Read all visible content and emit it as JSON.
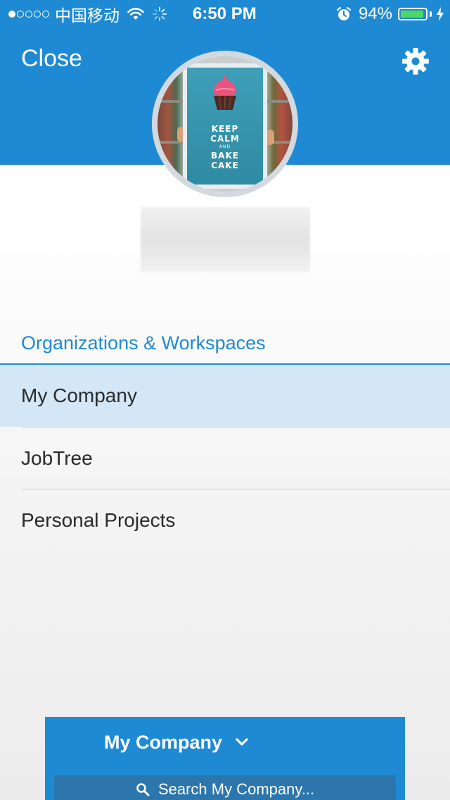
{
  "status_bar": {
    "carrier": "中国移动",
    "time": "6:50 PM",
    "battery_percent": "94%",
    "battery_level": 0.94,
    "signal_strength": 1,
    "signal_total": 5
  },
  "header": {
    "close_label": "Close",
    "settings_icon": "gear-icon",
    "background_color": "#1f8ad4"
  },
  "profile": {
    "avatar_poster_lines": [
      "KEEP",
      "CALM",
      "AND",
      "BAKE",
      "CAKE"
    ]
  },
  "organizations": {
    "title": "Organizations & Workspaces",
    "items": [
      {
        "label": "My Company",
        "selected": true
      },
      {
        "label": "JobTree",
        "selected": false
      },
      {
        "label": "Personal Projects",
        "selected": false
      }
    ]
  },
  "footer": {
    "workspace_label": "My Company",
    "search_placeholder": "Search My Company..."
  },
  "colors": {
    "accent": "#1f8ad4",
    "selected_row": "#d4e7f7",
    "battery_green": "#4cd964"
  }
}
